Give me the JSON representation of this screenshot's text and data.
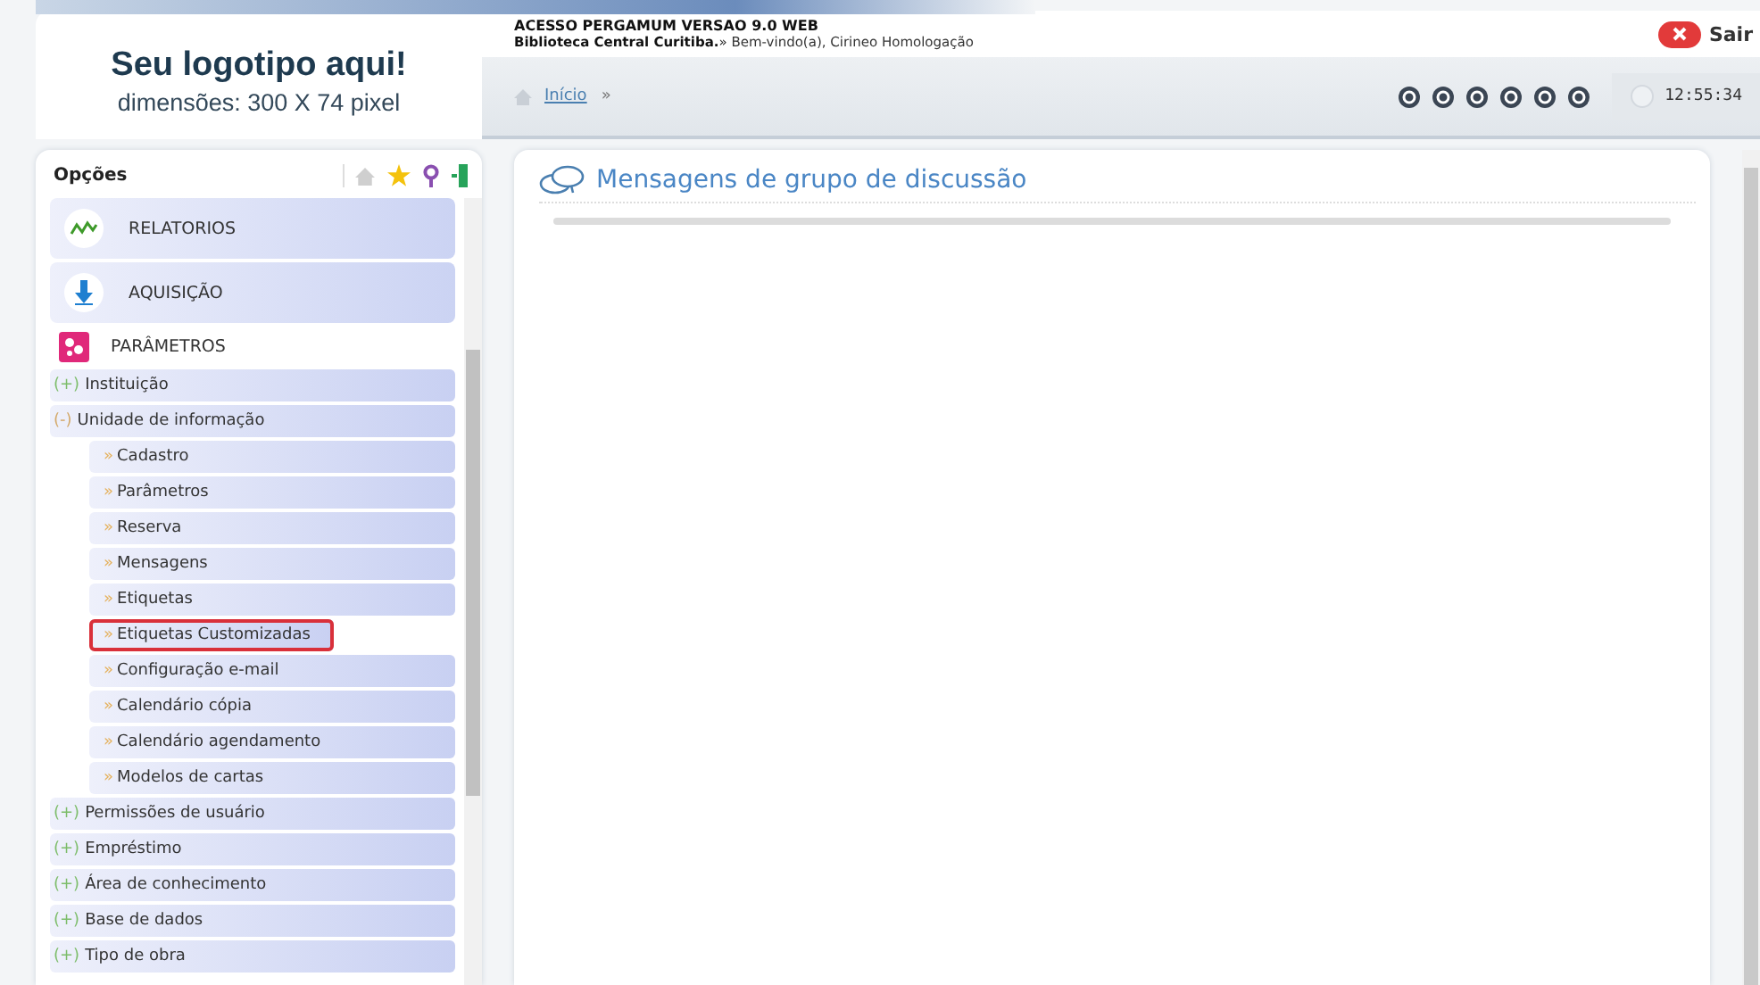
{
  "logo": {
    "title": "Seu logotipo aqui!",
    "subtitle": "dimensões: 300 X 74 pixel"
  },
  "header": {
    "title": "ACESSO PERGAMUM VERSAO 9.0 WEB",
    "library": "Biblioteca Central Curitiba.",
    "welcome": "» Bem-vindo(a), Cirineo Homologação",
    "logout": "Sair",
    "breadcrumb": "Início",
    "separator": "»",
    "time": "12:55:34"
  },
  "sidebar": {
    "title": "Opções",
    "modules": [
      {
        "label": "RELATORIOS",
        "kind": "chart",
        "expanded": false
      },
      {
        "label": "AQUISIÇÃO",
        "kind": "download",
        "expanded": false
      },
      {
        "label": "PARÂMETROS",
        "kind": "puzzle",
        "expanded": true,
        "children": [
          {
            "label": "Instituição",
            "marker": "(+)",
            "expanded": false
          },
          {
            "label": "Unidade de informação",
            "marker": "(-)",
            "expanded": true,
            "children": [
              {
                "label": "Cadastro",
                "marker": "»",
                "highlighted": false
              },
              {
                "label": "Parâmetros",
                "marker": "»",
                "highlighted": false
              },
              {
                "label": "Reserva",
                "marker": "»",
                "highlighted": false
              },
              {
                "label": "Mensagens",
                "marker": "»",
                "highlighted": false
              },
              {
                "label": "Etiquetas",
                "marker": "»",
                "highlighted": false
              },
              {
                "label": "Etiquetas Customizadas",
                "marker": "»",
                "highlighted": true
              },
              {
                "label": "Configuração e-mail",
                "marker": "»",
                "highlighted": false
              },
              {
                "label": "Calendário cópia",
                "marker": "»",
                "highlighted": false
              },
              {
                "label": "Calendário agendamento",
                "marker": "»",
                "highlighted": false
              },
              {
                "label": "Modelos de cartas",
                "marker": "»",
                "highlighted": false
              }
            ]
          },
          {
            "label": "Permissões de usuário",
            "marker": "(+)",
            "expanded": false
          },
          {
            "label": "Empréstimo",
            "marker": "(+)",
            "expanded": false
          },
          {
            "label": "Área de conhecimento",
            "marker": "(+)",
            "expanded": false
          },
          {
            "label": "Base de dados",
            "marker": "(+)",
            "expanded": false
          },
          {
            "label": "Tipo de obra",
            "marker": "(+)",
            "expanded": false
          }
        ]
      }
    ]
  },
  "content": {
    "title": "Mensagens de grupo de discussão"
  }
}
